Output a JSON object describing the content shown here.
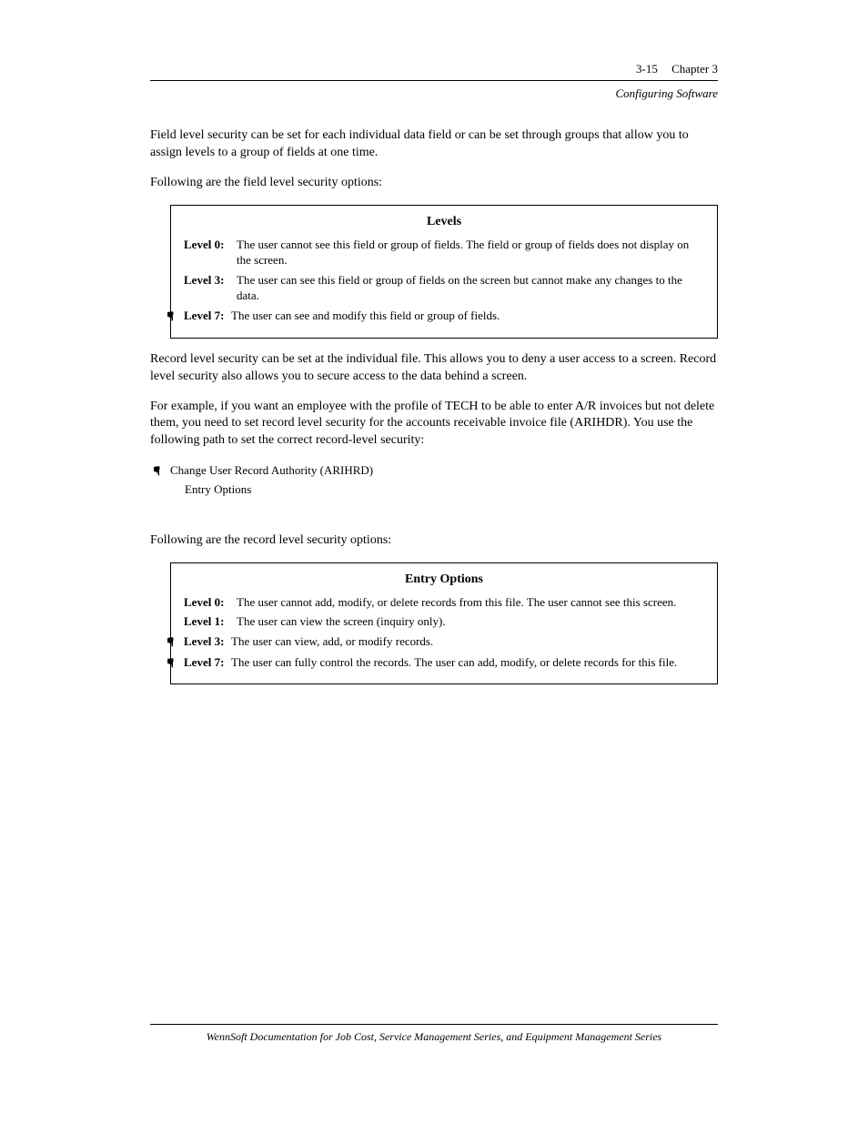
{
  "header": {
    "page_number": "3-15",
    "chapter": "Chapter 3",
    "sub": "Configuring Software"
  },
  "body": {
    "para1": "Field level security can be set for each individual data field or can be set through groups that allow you to assign levels to a group of fields at one time.",
    "para2": "Following are the field level security options:",
    "box1": {
      "title": "Levels",
      "rows": [
        {
          "label": "Level 0:",
          "desc": "The user cannot see this field or group of fields. The field or group of fields does not display on the screen."
        },
        {
          "label": "Level 3:",
          "desc": "The user can see this field or group of fields on the screen but cannot make any changes to the data."
        },
        {
          "label": "Level 7:",
          "desc": "The user can see and modify this field or group of fields.",
          "icon": true
        }
      ]
    },
    "para3": "Record level security can be set at the individual file. This allows you to deny a user access to a screen. Record level security also allows you to secure access to the data behind a screen.",
    "para4": "For example, if you want an employee with the profile of TECH to be able to enter A/R invoices but not delete them, you need to set record level security for the accounts receivable invoice file (ARIHDR). You use the following path to set the correct record-level security:",
    "path": {
      "line1": "Change User Record Authority (ARIHRD)",
      "line2": "Entry Options",
      "icon": true
    },
    "para5": "Following are the record level security options:",
    "box2": {
      "title": "Entry Options",
      "rows": [
        {
          "label": "Level 0:",
          "desc": "The user cannot add, modify, or delete records from this file. The user cannot see this screen."
        },
        {
          "label": "Level 1:",
          "desc": "The user can view the screen (inquiry only)."
        },
        {
          "label": "Level 3:",
          "desc": "The user can view, add, or modify records.",
          "icon": true
        },
        {
          "label": "Level 7:",
          "desc": "The user can fully control the records. The user can add, modify, or delete records for this file.",
          "icon": true
        }
      ]
    }
  },
  "footer": {
    "text": "WennSoft Documentation for Job Cost, Service Management Series, and Equipment Management Series"
  }
}
